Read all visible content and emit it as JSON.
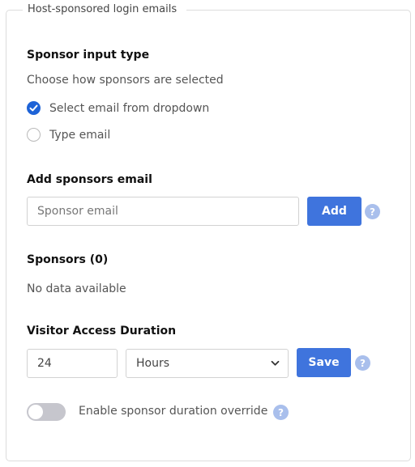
{
  "section": {
    "legend": "Host-sponsored login emails"
  },
  "sponsor_input": {
    "heading": "Sponsor input type",
    "description": "Choose how sponsors are selected",
    "options": [
      {
        "label": "Select email from dropdown",
        "checked": true
      },
      {
        "label": "Type email",
        "checked": false
      }
    ]
  },
  "add_sponsor": {
    "heading": "Add sponsors email",
    "placeholder": "Sponsor email",
    "button_label": "Add"
  },
  "sponsors": {
    "heading": "Sponsors (0)",
    "empty_text": "No data available"
  },
  "access_duration": {
    "heading": "Visitor Access Duration",
    "value": "24",
    "unit_selected": "Hours",
    "save_label": "Save"
  },
  "override": {
    "label": "Enable sponsor duration override",
    "enabled": false
  },
  "colors": {
    "accent": "#3f74dd",
    "radio_checked": "#1e63d7",
    "help_icon": "#a9bfec",
    "toggle_off": "#c6c6cd"
  },
  "icons": {
    "check": "check-icon",
    "help": "help-icon",
    "dropdown": "chevron-down-icon"
  }
}
